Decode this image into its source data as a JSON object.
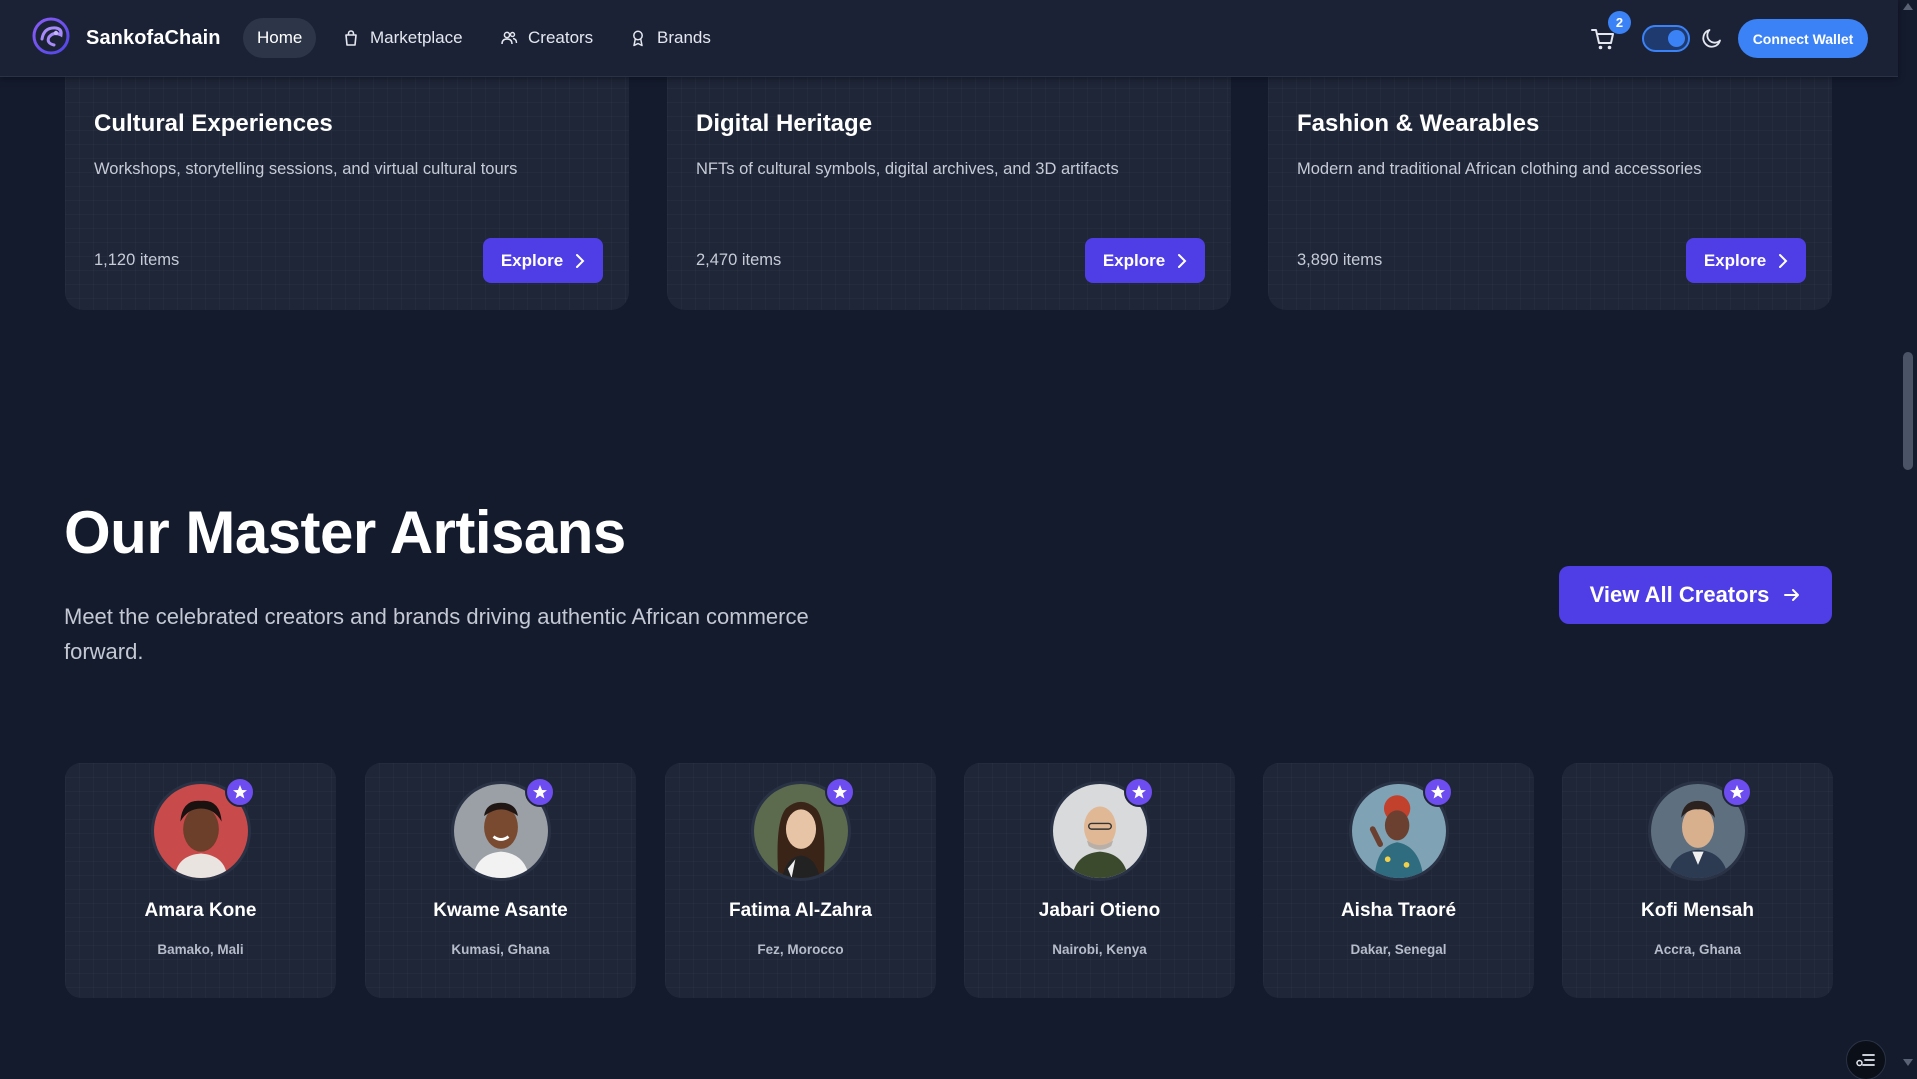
{
  "header": {
    "brand": "SankofaChain",
    "nav": [
      {
        "label": "Home",
        "icon": "home"
      },
      {
        "label": "Marketplace",
        "icon": "bag-icon"
      },
      {
        "label": "Creators",
        "icon": "users-icon"
      },
      {
        "label": "Brands",
        "icon": "award-icon"
      }
    ],
    "cart_count": "2",
    "connect_label": "Connect Wallet"
  },
  "categories": [
    {
      "title": "Cultural Experiences",
      "description": "Workshops, storytelling sessions, and virtual cultural tours",
      "count": "1,120 items",
      "button": "Explore"
    },
    {
      "title": "Digital Heritage",
      "description": "NFTs of cultural symbols, digital archives, and 3D artifacts",
      "count": "2,470 items",
      "button": "Explore"
    },
    {
      "title": "Fashion & Wearables",
      "description": "Modern and traditional African clothing and accessories",
      "count": "3,890 items",
      "button": "Explore"
    }
  ],
  "section": {
    "title": "Our Master Artisans",
    "subtitle": "Meet the celebrated creators and brands driving authentic African commerce forward.",
    "view_all": "View All Creators"
  },
  "artisans": [
    {
      "name": "Amara Kone",
      "location": "Bamako, Mali"
    },
    {
      "name": "Kwame Asante",
      "location": "Kumasi, Ghana"
    },
    {
      "name": "Fatima Al-Zahra",
      "location": "Fez, Morocco"
    },
    {
      "name": "Jabari Otieno",
      "location": "Nairobi, Kenya"
    },
    {
      "name": "Aisha Traoré",
      "location": "Dakar, Senegal"
    },
    {
      "name": "Kofi Mensah",
      "location": "Accra, Ghana"
    }
  ],
  "colors": {
    "background": "#141b2d",
    "card": "#1f2638",
    "accent": "#4f3ee6",
    "wallet": "#3b82f6"
  }
}
